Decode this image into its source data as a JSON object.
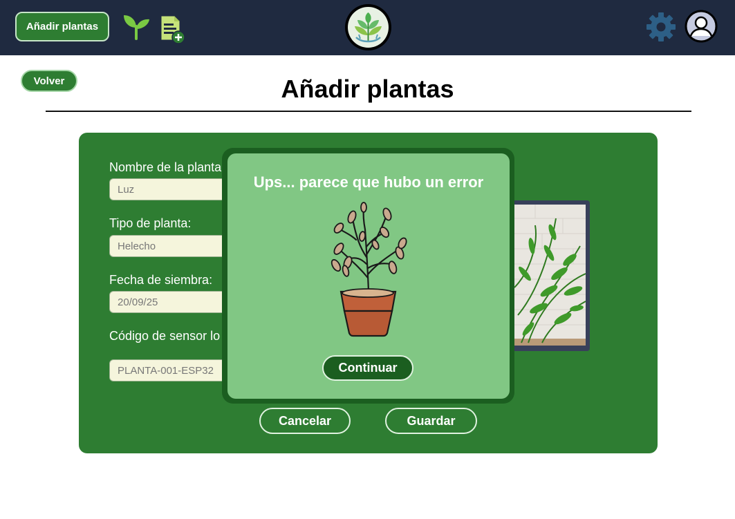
{
  "topbar": {
    "add_button_label": "Añadir plantas",
    "icons": [
      "sprout-icon",
      "document-add-icon",
      "app-logo",
      "gear-icon",
      "user-avatar-icon"
    ]
  },
  "page": {
    "back_label": "Volver",
    "title": "Añadir plantas"
  },
  "form": {
    "fields": [
      {
        "label": "Nombre de la planta:",
        "value": "Luz"
      },
      {
        "label": "Tipo de planta:",
        "value": "Helecho"
      },
      {
        "label": "Fecha de siembra:",
        "value": "20/09/25"
      },
      {
        "label": "Código de sensor lo",
        "value": "PLANTA-001-ESP32"
      }
    ],
    "cancel_label": "Cancelar",
    "save_label": "Guardar"
  },
  "modal": {
    "title": "Ups... parece que hubo un error",
    "continue_label": "Continuar",
    "illustration": "wilted-plant-icon"
  },
  "colors": {
    "topbar": "#1f2a40",
    "accent_green": "#2e7d32",
    "modal_green": "#81c784",
    "modal_frame": "#1b5e20",
    "input_bg": "#f5f5dc"
  }
}
